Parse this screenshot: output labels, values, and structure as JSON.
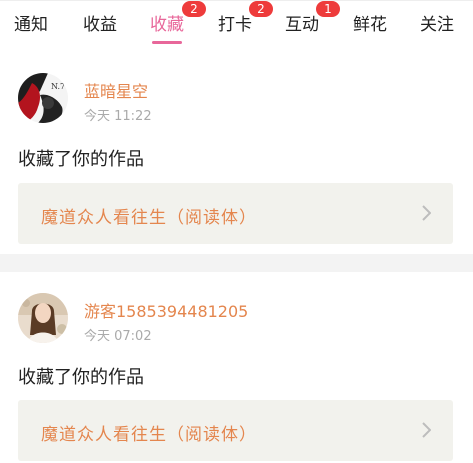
{
  "tabs": [
    {
      "label": "通知",
      "badge": null
    },
    {
      "label": "收益",
      "badge": null
    },
    {
      "label": "收藏",
      "badge": "2",
      "active": true
    },
    {
      "label": "打卡",
      "badge": "2"
    },
    {
      "label": "互动",
      "badge": "1"
    },
    {
      "label": "鲜花",
      "badge": null
    },
    {
      "label": "关注",
      "badge": null
    }
  ],
  "items": [
    {
      "username": "蓝暗星空",
      "time": "今天 11:22",
      "action": "收藏了你的作品",
      "work_title": "魔道众人看往生（阅读体）",
      "avatar_icon": "dark-red-figure-avatar"
    },
    {
      "username": "游客1585394481205",
      "time": "今天 07:02",
      "action": "收藏了你的作品",
      "work_title": "魔道众人看往生（阅读体）",
      "avatar_icon": "girl-photo-avatar"
    }
  ],
  "colors": {
    "accent_pink": "#e8679a",
    "name_orange": "#e4864e",
    "badge_red": "#ee3b3b",
    "card_bg": "#f2f2ed"
  }
}
